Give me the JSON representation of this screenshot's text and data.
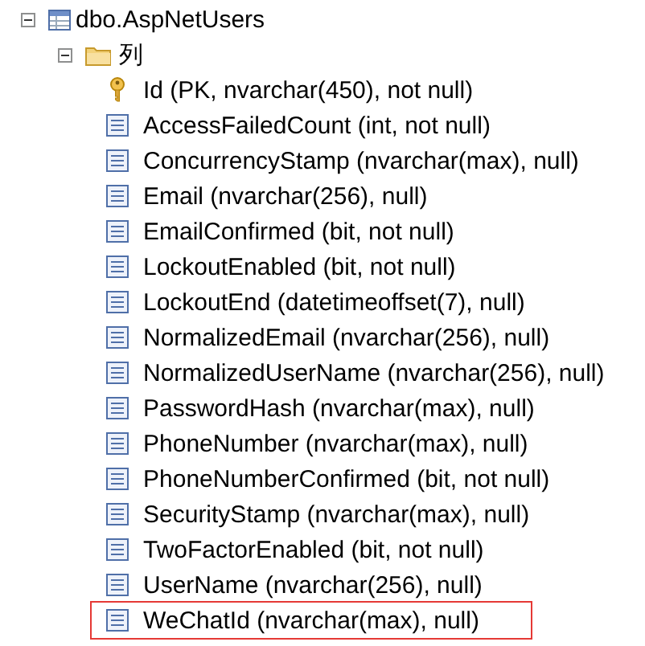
{
  "tree": {
    "label": "dbo.AspNetUsers",
    "kind": "table",
    "expanded": true,
    "children": [
      {
        "label": "列",
        "kind": "folder",
        "expanded": true,
        "children": [
          {
            "label": "Id (PK, nvarchar(450), not null)",
            "kind": "key",
            "highlighted": false
          },
          {
            "label": "AccessFailedCount (int, not null)",
            "kind": "column",
            "highlighted": false
          },
          {
            "label": "ConcurrencyStamp (nvarchar(max), null)",
            "kind": "column",
            "highlighted": false
          },
          {
            "label": "Email (nvarchar(256), null)",
            "kind": "column",
            "highlighted": false
          },
          {
            "label": "EmailConfirmed (bit, not null)",
            "kind": "column",
            "highlighted": false
          },
          {
            "label": "LockoutEnabled (bit, not null)",
            "kind": "column",
            "highlighted": false
          },
          {
            "label": "LockoutEnd (datetimeoffset(7), null)",
            "kind": "column",
            "highlighted": false
          },
          {
            "label": "NormalizedEmail (nvarchar(256), null)",
            "kind": "column",
            "highlighted": false
          },
          {
            "label": "NormalizedUserName (nvarchar(256), null)",
            "kind": "column",
            "highlighted": false
          },
          {
            "label": "PasswordHash (nvarchar(max), null)",
            "kind": "column",
            "highlighted": false
          },
          {
            "label": "PhoneNumber (nvarchar(max), null)",
            "kind": "column",
            "highlighted": false
          },
          {
            "label": "PhoneNumberConfirmed (bit, not null)",
            "kind": "column",
            "highlighted": false
          },
          {
            "label": "SecurityStamp (nvarchar(max), null)",
            "kind": "column",
            "highlighted": false
          },
          {
            "label": "TwoFactorEnabled (bit, not null)",
            "kind": "column",
            "highlighted": false
          },
          {
            "label": "UserName (nvarchar(256), null)",
            "kind": "column",
            "highlighted": false
          },
          {
            "label": "WeChatId (nvarchar(max), null)",
            "kind": "column",
            "highlighted": true
          }
        ]
      }
    ]
  }
}
